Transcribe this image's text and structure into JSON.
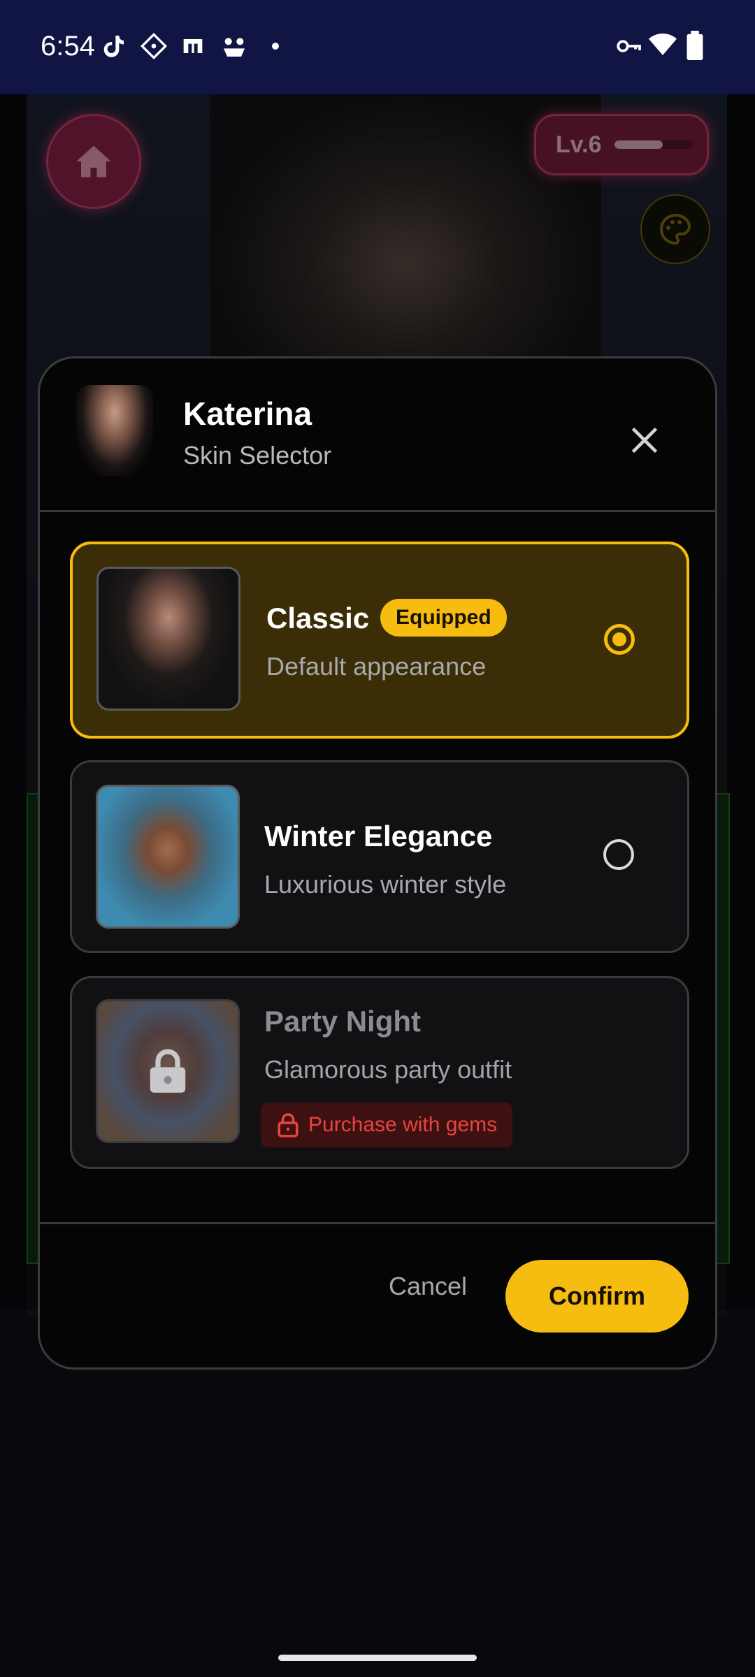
{
  "status_bar": {
    "time": "6:54",
    "left_icons": [
      "tiktok-icon",
      "diamond-app-icon",
      "printer-app-icon",
      "game-app-icon",
      "dot-icon"
    ],
    "right_icons": [
      "vpn-key-icon",
      "wifi-icon",
      "battery-icon"
    ]
  },
  "background": {
    "level_label": "Lv.6",
    "level_progress": 0.62
  },
  "modal": {
    "character_name": "Katerina",
    "subtitle": "Skin Selector",
    "skins": [
      {
        "title": "Classic",
        "badge": "Equipped",
        "description": "Default appearance",
        "selected": true,
        "locked": false
      },
      {
        "title": "Winter Elegance",
        "description": "Luxurious winter style",
        "selected": false,
        "locked": false
      },
      {
        "title": "Party Night",
        "description": "Glamorous party outfit",
        "selected": false,
        "locked": true,
        "action_label": "Purchase with gems"
      }
    ],
    "cancel_label": "Cancel",
    "confirm_label": "Confirm"
  },
  "colors": {
    "accent": "#f6bd10",
    "locked_red": "#e9443d",
    "level_pink": "#b3385f"
  }
}
